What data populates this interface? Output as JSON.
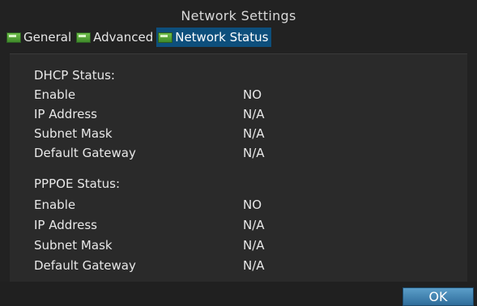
{
  "window": {
    "title": "Network Settings"
  },
  "tabs": [
    {
      "label": "General",
      "icon": "network-tab-icon",
      "active": false
    },
    {
      "label": "Advanced",
      "icon": "network-tab-icon",
      "active": false
    },
    {
      "label": "Network Status",
      "icon": "network-tab-icon",
      "active": true
    }
  ],
  "dhcp": {
    "title": "DHCP Status:",
    "rows": [
      {
        "label": "Enable",
        "value": "NO"
      },
      {
        "label": "IP Address",
        "value": "N/A"
      },
      {
        "label": "Subnet Mask",
        "value": "N/A"
      },
      {
        "label": "Default Gateway",
        "value": "N/A"
      }
    ]
  },
  "pppoe": {
    "title": "PPPOE Status:",
    "rows": [
      {
        "label": "Enable",
        "value": "NO"
      },
      {
        "label": "IP Address",
        "value": "N/A"
      },
      {
        "label": "Subnet Mask",
        "value": "N/A"
      },
      {
        "label": "Default Gateway",
        "value": "N/A"
      }
    ]
  },
  "footer": {
    "ok_label": "OK"
  }
}
